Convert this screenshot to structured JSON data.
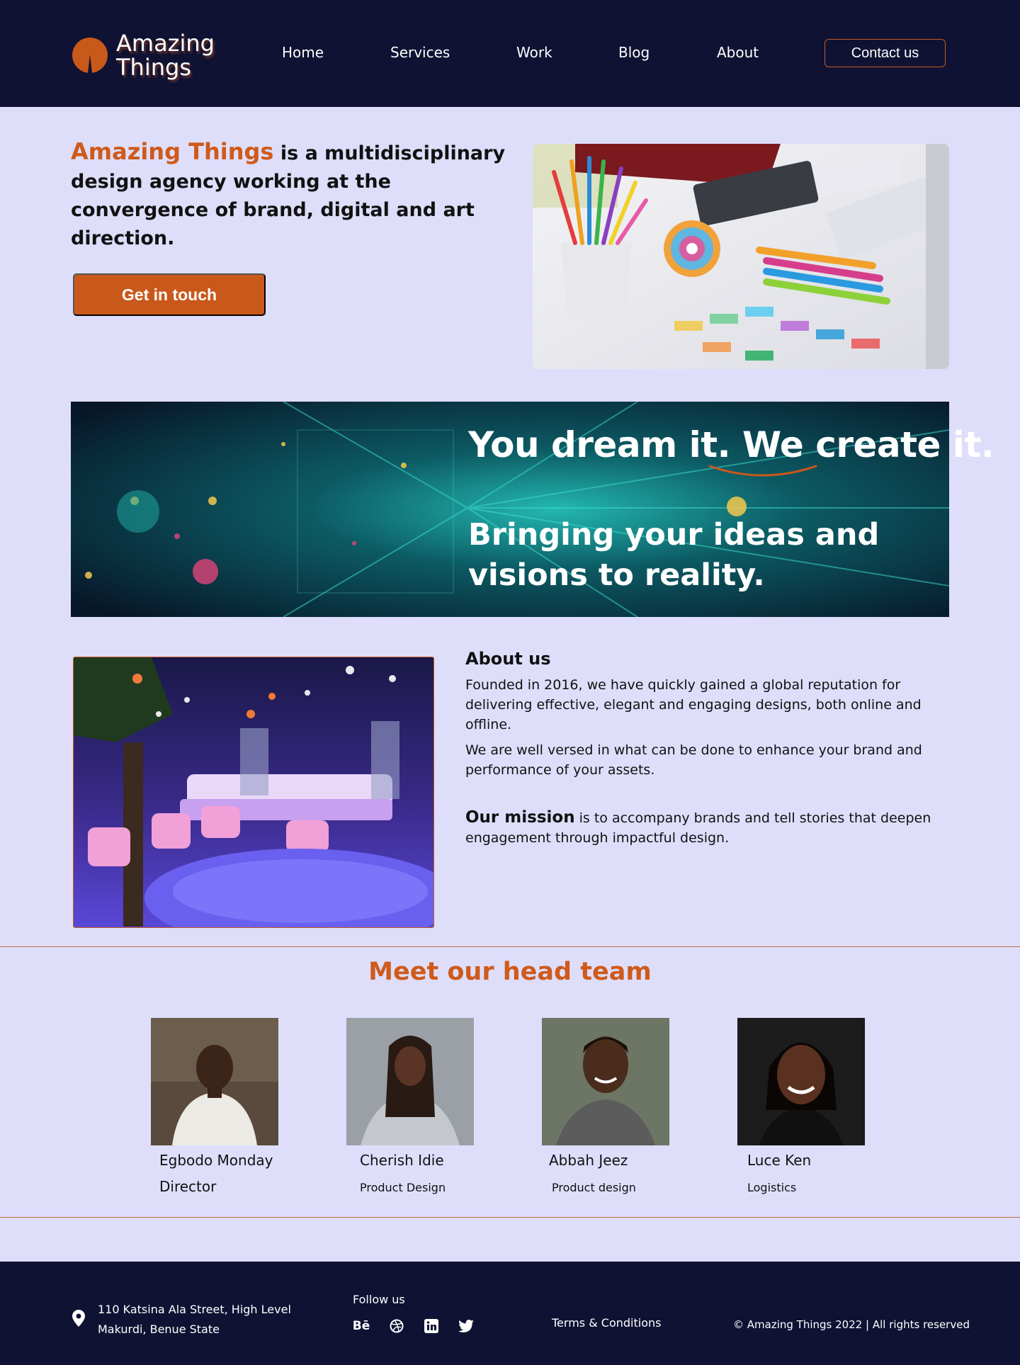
{
  "header": {
    "logo_line1": "Amazing",
    "logo_line2": "Things",
    "nav": [
      "Home",
      "Services",
      "Work",
      "Blog",
      "About"
    ],
    "contact_label": "Contact us"
  },
  "hero": {
    "brand": "Amazing Things",
    "tagline": " is a multidisciplinary design agency working at the convergence of brand, digital and art direction.",
    "cta_label": "Get in touch"
  },
  "banner": {
    "headline": "You dream it. We create it.",
    "subheadline": "Bringing your ideas and visions to reality."
  },
  "about": {
    "title": "About us",
    "paragraph1": "Founded in 2016, we have quickly gained a global reputation for delivering effective, elegant and engaging designs, both online and offline.",
    "paragraph2": "We are well versed in what can be done to enhance your brand and performance of your assets.",
    "mission_label": "Our mission",
    "mission_text": " is to accompany brands and tell stories that deepen engagement through impactful design."
  },
  "team": {
    "title": "Meet our head  team",
    "members": [
      {
        "name": "Egbodo Monday",
        "role": "Director"
      },
      {
        "name": "Cherish Idie",
        "role": "Product Design"
      },
      {
        "name": "Abbah Jeez",
        "role": "Product design"
      },
      {
        "name": "Luce Ken",
        "role": "Logistics"
      }
    ]
  },
  "footer": {
    "address_line1": "110 Katsina Ala Street, High Level",
    "address_line2": "Makurdi, Benue State",
    "follow_label": "Follow us",
    "social": [
      "behance-icon",
      "dribbble-icon",
      "linkedin-icon",
      "twitter-icon"
    ],
    "terms_label": "Terms & Conditions",
    "copyright": "© Amazing Things 2022 | All rights reserved"
  },
  "colors": {
    "accent": "#c9581b",
    "navy": "#0f1233",
    "background": "#dedefb"
  }
}
